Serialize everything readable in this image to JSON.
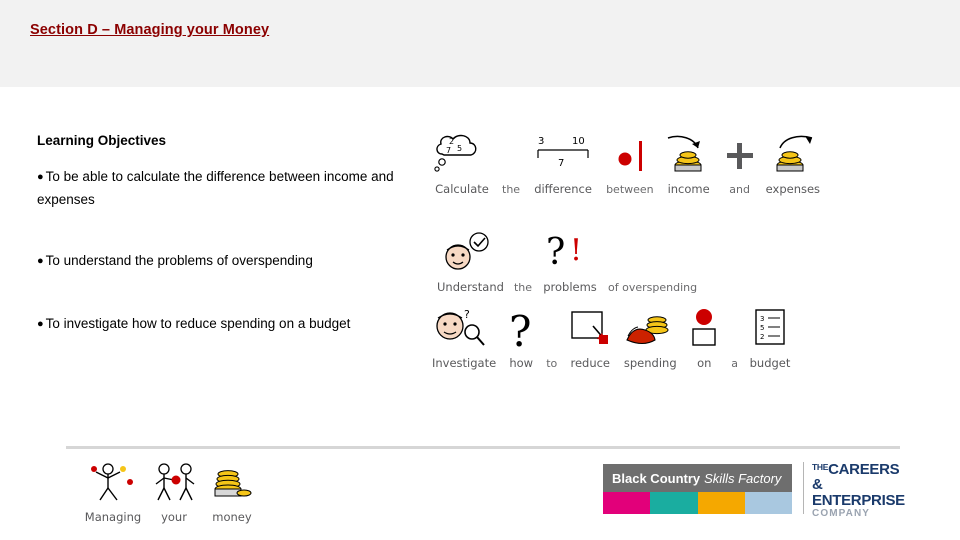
{
  "header": {
    "title": "Section D – Managing your Money",
    "band_color": "#f2f2f2",
    "title_color": "#8b0000"
  },
  "learning_objectives": {
    "heading": "Learning Objectives",
    "bullets": [
      "To be able to calculate the difference between income and expenses",
      "To understand the problems of overspending",
      "To investigate how to reduce spending on a budget"
    ]
  },
  "symbol_rows": [
    {
      "id": "row1",
      "cells": [
        {
          "label": "Calculate",
          "icon": "thought-bubble-numbers-icon",
          "emphasis": "strong"
        },
        {
          "label": "the",
          "icon": "blank-icon",
          "emphasis": "weak"
        },
        {
          "label": "difference",
          "icon": "number-line-3-10-icon",
          "emphasis": "strong"
        },
        {
          "label": "between",
          "icon": "red-dot-bar-icon",
          "emphasis": "weak"
        },
        {
          "label": "income",
          "icon": "coins-arrow-in-icon",
          "emphasis": "strong"
        },
        {
          "label": "and",
          "icon": "plus-sign-icon",
          "emphasis": "weak"
        },
        {
          "label": "expenses",
          "icon": "coins-arrow-out-icon",
          "emphasis": "strong"
        }
      ]
    },
    {
      "id": "row2",
      "cells": [
        {
          "label": "Understand",
          "icon": "head-checkmark-icon",
          "emphasis": "strong"
        },
        {
          "label": "the",
          "icon": "blank-icon",
          "emphasis": "weak"
        },
        {
          "label": "problems",
          "icon": "question-exclamation-icon",
          "emphasis": "strong"
        },
        {
          "label": "of overspending",
          "icon": "blank-icon",
          "emphasis": "weak"
        }
      ]
    },
    {
      "id": "row3",
      "cells": [
        {
          "label": "Investigate",
          "icon": "head-magnifier-icon",
          "emphasis": "strong"
        },
        {
          "label": "how",
          "icon": "question-mark-icon",
          "emphasis": "strong"
        },
        {
          "label": "to",
          "icon": "blank-icon",
          "emphasis": "weak"
        },
        {
          "label": "reduce",
          "icon": "square-arrow-down-icon",
          "emphasis": "strong"
        },
        {
          "label": "spending",
          "icon": "hand-coins-icon",
          "emphasis": "strong"
        },
        {
          "label": "on",
          "icon": "red-circle-square-icon",
          "emphasis": "strong"
        },
        {
          "label": "a",
          "icon": "blank-icon",
          "emphasis": "weak"
        },
        {
          "label": "budget",
          "icon": "budget-list-icon",
          "emphasis": "strong"
        }
      ]
    },
    {
      "id": "rowbottom",
      "cells": [
        {
          "label": "Managing",
          "icon": "person-juggling-icon",
          "emphasis": "strong"
        },
        {
          "label": "your",
          "icon": "two-people-icon",
          "emphasis": "strong"
        },
        {
          "label": "money",
          "icon": "coins-stack-icon",
          "emphasis": "strong"
        }
      ]
    }
  ],
  "footer": {
    "bcsf": {
      "name_bold": "Black Country",
      "name_italic": "Skills Factory",
      "bar_colors": [
        "#e2007a",
        "#1aada0",
        "#f5a800",
        "#a9c8e0"
      ]
    },
    "careers_enterprise": {
      "the": "THE",
      "line1": "CAREERS &",
      "line2": "ENTERPRISE",
      "line3": "COMPANY",
      "color": "#1a3a6b"
    }
  }
}
